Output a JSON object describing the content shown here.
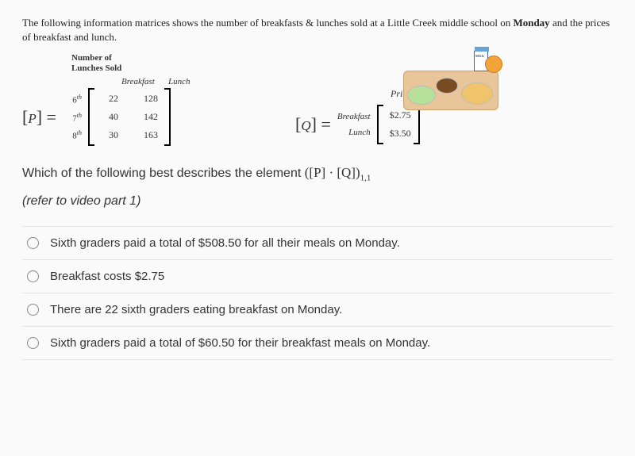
{
  "intro": {
    "text_a": "The following information matrices shows the number of breakfasts & lunches sold at a Little Creek middle school on ",
    "bold": "Monday",
    "text_b": " and the prices of breakfast and lunch."
  },
  "matrixP": {
    "title_l1": "Number of",
    "title_l2": "Lunches Sold",
    "cols": [
      "Breakfast",
      "Lunch"
    ],
    "label_prefix": "[",
    "label_letter": "P",
    "label_suffix": "] =",
    "grades": [
      "6",
      "7",
      "8"
    ],
    "grade_sup": "th",
    "rows": [
      {
        "a": "22",
        "b": "128"
      },
      {
        "a": "40",
        "b": "142"
      },
      {
        "a": "30",
        "b": "163"
      }
    ]
  },
  "matrixQ": {
    "title": "Price",
    "label_prefix": "[",
    "label_letter": "Q",
    "label_suffix": "] =",
    "row_labels": [
      "Breakfast",
      "Lunch"
    ],
    "rows": [
      {
        "v": "$2.75"
      },
      {
        "v": "$3.50"
      }
    ]
  },
  "milk_label": "MILK",
  "question": {
    "lead": "Which of the following best describes the element ",
    "expr": "([P] · [Q])",
    "subscript": "1,1"
  },
  "hint": "(refer to video part 1)",
  "options": [
    "Sixth graders paid a total of $508.50 for all their meals on Monday.",
    "Breakfast costs $2.75",
    "There are 22 sixth graders eating breakfast on Monday.",
    "Sixth graders paid a total of $60.50 for their breakfast meals on Monday."
  ]
}
